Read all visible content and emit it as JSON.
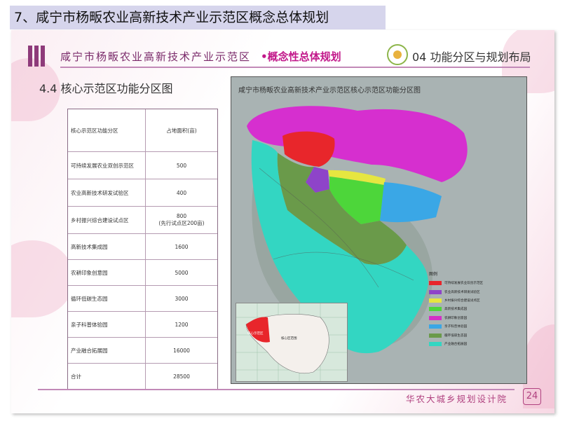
{
  "title_bar": "7、咸宁市杨畈农业高新技术产业示范区概念总体规划",
  "header": {
    "project": "咸宁市杨畈农业高新技术产业示范区",
    "accent": "•概念性总体规划",
    "section": "04 功能分区与规划布局"
  },
  "subtitle": "4.4 核心示范区功能分区图",
  "table": {
    "headers": [
      "核心示范区功能分区",
      "占地面积(亩)"
    ],
    "rows": [
      {
        "name": "可持续发展农业双创示范区",
        "area": "500",
        "note": ""
      },
      {
        "name": "农业高新技术研发试验区",
        "area": "400",
        "note": ""
      },
      {
        "name": "乡村振兴综合建设试点区",
        "area": "800",
        "note": "(先行试点区200亩)"
      },
      {
        "name": "高新技术集成园",
        "area": "1600",
        "note": ""
      },
      {
        "name": "农耕印象创意园",
        "area": "5000",
        "note": ""
      },
      {
        "name": "循环低碳生态园",
        "area": "3000",
        "note": ""
      },
      {
        "name": "亲子科普体验园",
        "area": "1200",
        "note": ""
      },
      {
        "name": "产业融合拓展园",
        "area": "16000",
        "note": ""
      },
      {
        "name": "合计",
        "area": "28500",
        "note": ""
      }
    ]
  },
  "map": {
    "title": "咸宁市杨畈农业高新技术产业示范区核心示范区功能分区图",
    "legend_title": "图例",
    "legend": [
      {
        "label": "可持续发展农业双创示范区",
        "color": "#e8262b"
      },
      {
        "label": "农业高新技术研发试验区",
        "color": "#8e44c9"
      },
      {
        "label": "乡村振兴综合建设试点区",
        "color": "#e6e640"
      },
      {
        "label": "高新技术集成园",
        "color": "#4dd63a"
      },
      {
        "label": "农耕印象创意园",
        "color": "#d42fc6"
      },
      {
        "label": "亲子科普体验园",
        "color": "#3aa7e6"
      },
      {
        "label": "循环低碳生态园",
        "color": "#6a9a4a"
      },
      {
        "label": "产业融合拓展园",
        "color": "#33d6c2"
      }
    ],
    "inset_labels": [
      "核心示范区",
      "核心区范围"
    ]
  },
  "footer": {
    "org": "华农大城乡规划设计院",
    "page": "24"
  }
}
